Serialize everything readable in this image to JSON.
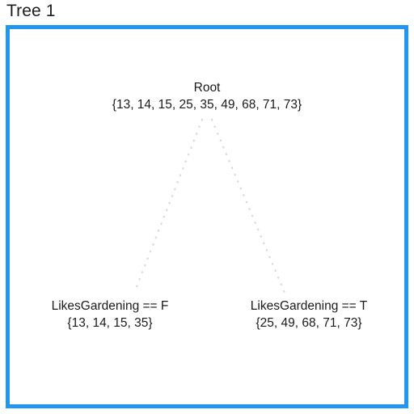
{
  "page": {
    "title": "Tree 1",
    "background_color": "#ffffff"
  },
  "panel": {
    "border_color": "#2196f3",
    "background_color": "#ffffff"
  },
  "tree": {
    "edge_style": "dotted",
    "edge_color": "#d9d9d9",
    "root": {
      "label": "Root",
      "set": "{13, 14, 15, 25, 35, 49, 68, 71, 73}",
      "values": [
        13,
        14,
        15,
        25,
        35,
        49,
        68,
        71,
        73
      ]
    },
    "children": [
      {
        "label": "LikesGardening == F",
        "set": "{13, 14, 15, 35}",
        "values": [
          13,
          14,
          15,
          35
        ]
      },
      {
        "label": "LikesGardening == T",
        "set": "{25, 49, 68, 71, 73}",
        "values": [
          25,
          49,
          68,
          71,
          73
        ]
      }
    ]
  }
}
